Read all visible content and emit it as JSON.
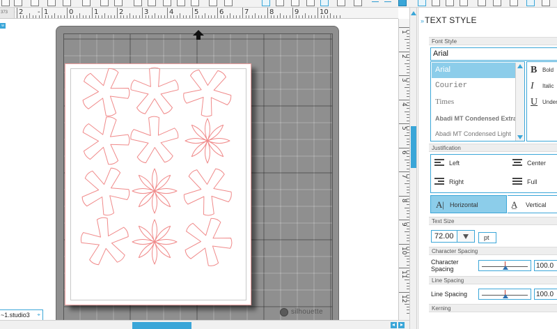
{
  "toolbar": {
    "icons": [
      "pointer-icon",
      "zoom-in-icon",
      "zoom-out-icon",
      "zoom-fit-icon",
      "heart-icon",
      "magnify-icon",
      "lines-icon",
      "text-icon",
      "shape-icon",
      "cut-icon",
      "send-icon"
    ]
  },
  "ruler": {
    "corner_value": "373",
    "top_labels": [
      "2",
      "1",
      "0",
      "1",
      "2",
      "3",
      "4",
      "5",
      "6",
      "7",
      "8",
      "9",
      "10"
    ],
    "top_prefix_neg": [
      "-",
      "-"
    ],
    "right_labels": [
      "1",
      "2",
      "3",
      "4",
      "5",
      "6",
      "7",
      "8",
      "9",
      "10",
      "11",
      "12"
    ]
  },
  "canvas": {
    "mini_tab": "w",
    "brand": "silhouette",
    "doc_tab": "~1.studio3",
    "mat_color": "#8f8f8f",
    "cut_line_color": "#f08a8a"
  },
  "panel": {
    "title": "TEXT STYLE",
    "font_style": {
      "header": "Font Style",
      "current": "Arial",
      "fonts": [
        "Arial",
        "Courier",
        "Times",
        "Abadi MT Condensed Extra",
        "Abadi MT Condensed Light"
      ],
      "selected_index": 0
    },
    "styles": [
      {
        "glyph": "B",
        "label": "Bold"
      },
      {
        "glyph": "I",
        "label": "Italic"
      },
      {
        "glyph": "U",
        "label": "Under"
      }
    ],
    "justification": {
      "header": "Justification",
      "options": [
        "Left",
        "Center",
        "Right",
        "Full"
      ]
    },
    "orientation": {
      "horizontal": "Horizontal",
      "vertical": "Vertical",
      "selected": "Horizontal"
    },
    "text_size": {
      "header": "Text Size",
      "value": "72.00",
      "unit": "pt"
    },
    "character_spacing": {
      "header": "Character Spacing",
      "label_line1": "Character",
      "label_line2": "Spacing",
      "value": "100.0",
      "slider_fraction": 0.5
    },
    "line_spacing": {
      "header": "Line Spacing",
      "label": "Line Spacing",
      "value": "100.0",
      "slider_fraction": 0.5
    },
    "kerning": {
      "header": "Kerning"
    },
    "accent_color": "#3aa6d8",
    "selected_color": "#8ccdea"
  }
}
